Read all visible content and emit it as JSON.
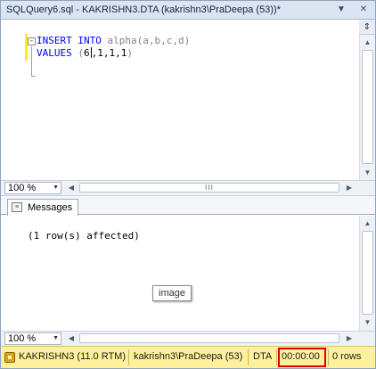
{
  "window": {
    "title": "SQLQuery6.sql - KAKRISHN3.DTA (kakrishn3\\PraDeepa (53))*",
    "dropdown_glyph": "▼",
    "close_glyph": "✕",
    "pin_glyph": "⇕"
  },
  "editor": {
    "line1": {
      "kw1": "INSERT",
      "kw2": "INTO",
      "rest": "alpha(a,b,c,d)"
    },
    "line2": {
      "kw": "VALUES",
      "open": "(",
      "before_caret": "6",
      "after_caret": ",1,1,1",
      "close": ")"
    },
    "collapse_glyph": "-"
  },
  "zoom_top": {
    "value": "100 %"
  },
  "zoom_bottom": {
    "value": "100 %"
  },
  "results": {
    "tab_label": "Messages",
    "message": "(1 row(s) affected)",
    "tooltip": "image"
  },
  "status_bar": {
    "server": "KAKRISHN3 (11.0 RTM)",
    "user": "kakrishn3\\PraDeepa (53)",
    "database": "DTA",
    "elapsed": "00:00:00",
    "rows": "0 rows"
  },
  "colors": {
    "keyword": "#0000ff",
    "status_bar": "#fff19b",
    "highlight_box": "#e00000"
  },
  "icons": {
    "dropdown": "chevron-down-icon",
    "close": "close-icon",
    "split": "split-icon",
    "messages": "messages-icon",
    "server": "server-icon"
  }
}
